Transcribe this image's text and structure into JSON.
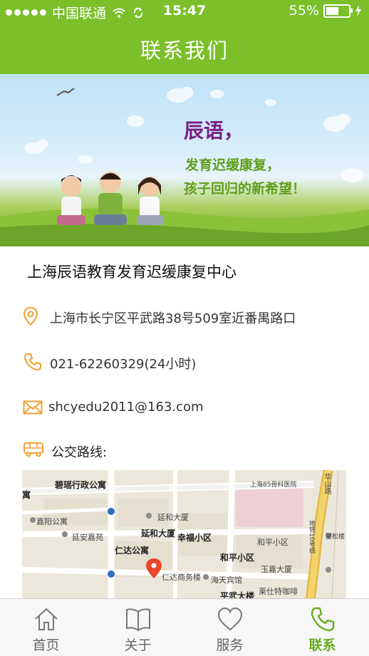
{
  "status_bar": {
    "carrier": "中国联通",
    "time": "15:47",
    "battery": "55%",
    "battery_level": 0.55
  },
  "nav": {
    "title": "联系我们"
  },
  "banner": {
    "slogan_line1": "辰语，",
    "slogan_line2": "发育迟缓康复，",
    "slogan_line3": "孩子回归的新希望！"
  },
  "contact": {
    "name": "上海辰语教育发育迟缓康复中心",
    "address": "上海市长宁区平武路38号509室近番禺路口",
    "phone": "021-62260329(24小时)",
    "email": "shcyedu2011@163.com",
    "bus_label": "公交路线:"
  },
  "map": {
    "labels": [
      "碧瑶行政公寓",
      "嘉阳公寓",
      "延安嘉苑",
      "延和大厦",
      "延和大厦",
      "幸福小区",
      "仁达公寓",
      "和平小区",
      "和平小区",
      "仁达商务楼",
      "海天宾馆",
      "玉嘉大厦",
      "平武大楼",
      "莱仕特咖啡",
      "上海85骨科医院",
      "望松楼",
      "华山路",
      "地铁10号线",
      "寓"
    ]
  },
  "tabs": [
    {
      "label": "首页",
      "icon": "home-icon"
    },
    {
      "label": "关于",
      "icon": "book-icon"
    },
    {
      "label": "服务",
      "icon": "heart-icon"
    },
    {
      "label": "联系",
      "icon": "phone-icon"
    }
  ],
  "colors": {
    "brand_green": "#7bbf2a",
    "icon_orange": "#f0a030",
    "active_tab": "#6aac22"
  }
}
